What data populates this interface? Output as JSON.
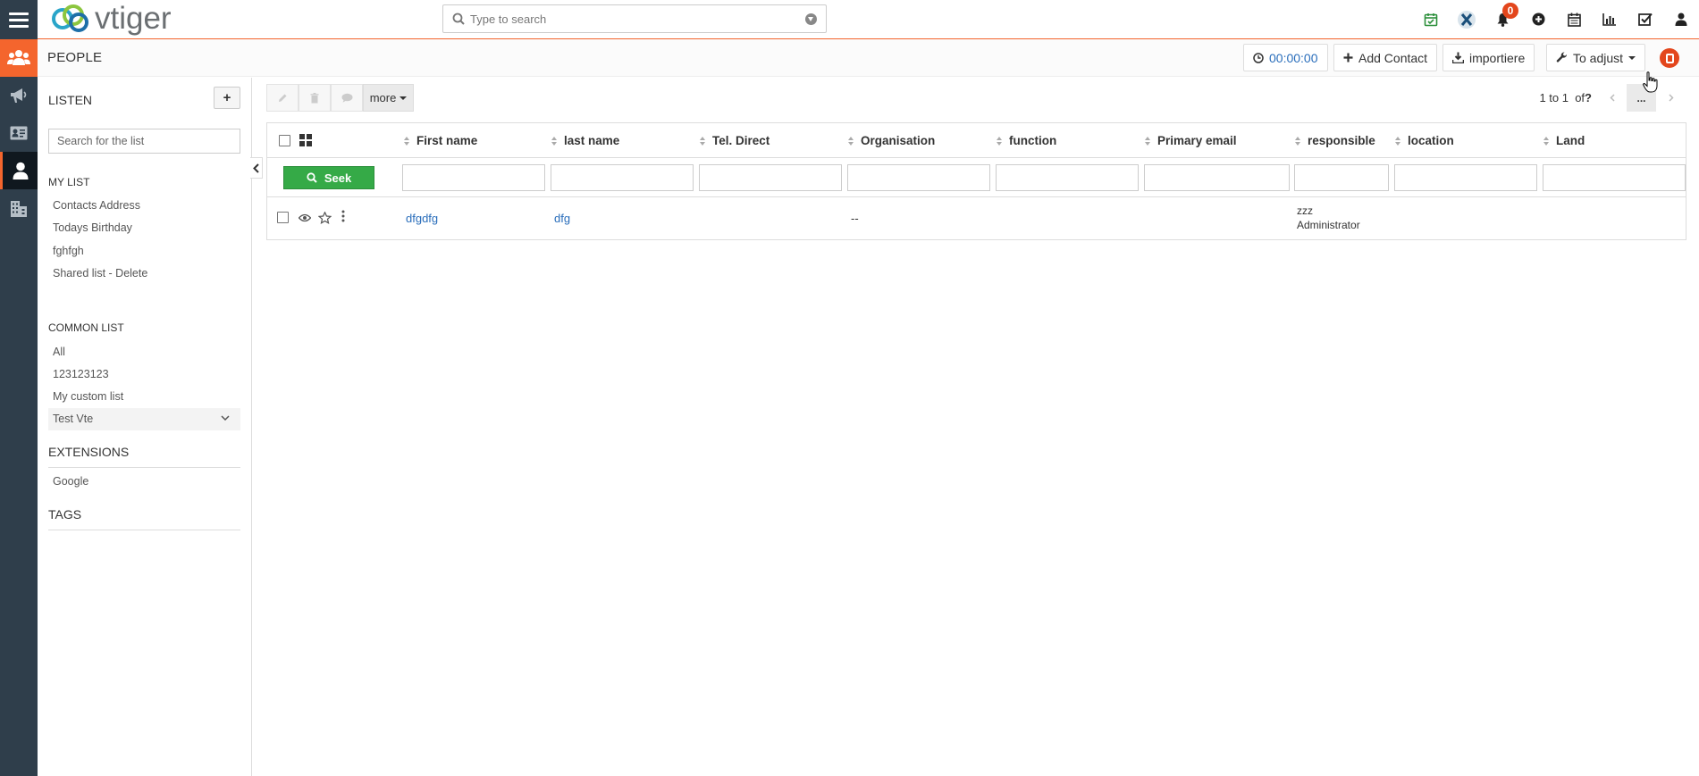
{
  "topbar": {
    "logo_text": "vtiger",
    "search_placeholder": "Type to search",
    "notifications_count": "0",
    "icons": [
      "calendar-check-icon",
      "vtiger-x-icon",
      "bell-icon",
      "plus-circle-icon",
      "calendar-icon",
      "bar-chart-icon",
      "checkbox-icon",
      "user-icon"
    ]
  },
  "rail": {
    "items": [
      "contacts-icon",
      "megaphone-icon",
      "id-card-icon",
      "person-icon",
      "building-icon"
    ]
  },
  "module": {
    "title": "PEOPLE",
    "timer": "00:00:00",
    "add_contact": "Add Contact",
    "import": "importiere",
    "adjust": "To adjust"
  },
  "sidebar": {
    "lists_title": "LISTEN",
    "search_placeholder": "Search for the list",
    "my_list_title": "MY LIST",
    "my_list": [
      "Contacts Address",
      "Todays Birthday",
      "fghfgh",
      "Shared list - Delete"
    ],
    "common_list_title": "COMMON LIST",
    "common_list": [
      "All",
      "123123123",
      "My custom list",
      "Test Vte"
    ],
    "extensions_title": "EXTENSIONS",
    "extensions": [
      "Google"
    ],
    "tags_title": "TAGS"
  },
  "toolbar": {
    "more_label": "more"
  },
  "pager": {
    "range": "1 to 1",
    "of": "of",
    "total": "?",
    "mid": "..."
  },
  "table": {
    "columns": [
      "First name",
      "last name",
      "Tel. Direct",
      "Organisation",
      "function",
      "Primary email",
      "responsible",
      "location",
      "Land"
    ],
    "seek_label": "Seek",
    "rows": [
      {
        "first_name": "dfgdfg",
        "last_name": "dfg",
        "tel_direct": "",
        "organisation": "--",
        "function": "",
        "primary_email": "",
        "responsible_line1": "zzz",
        "responsible_line2": "Administrator",
        "location": "",
        "land": ""
      }
    ]
  },
  "colors": {
    "accent": "#f4652d",
    "rail": "#2f3e4b",
    "link": "#2a6ebb",
    "seek": "#35aa47",
    "badge": "#e3461c"
  }
}
